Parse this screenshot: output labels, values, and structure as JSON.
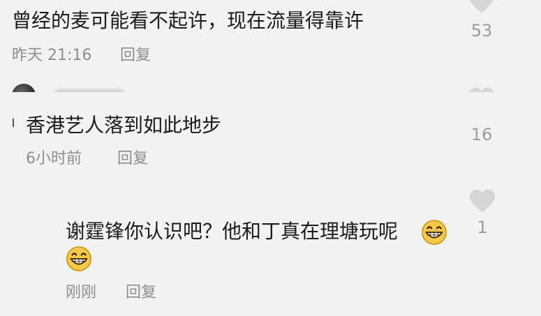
{
  "comments": [
    {
      "text": "曾经的麦可能看不起许，现在流量得靠许",
      "time": "昨天 21:16",
      "reply_label": "回复",
      "like_count": "53"
    },
    {
      "text": "香港艺人落到如此地步",
      "time": "6小时前",
      "reply_label": "回复",
      "like_count": "16"
    },
    {
      "text": "谢霆锋你认识吧？他和丁真在理塘玩呢",
      "time": "刚刚",
      "reply_label": "回复",
      "like_count": "1",
      "emojis": [
        "grinning-face",
        "grinning-face"
      ]
    }
  ],
  "colors": {
    "background": "#f2f2f2",
    "heart": "#d6d6d6",
    "meta_text": "#8e8e8e"
  }
}
